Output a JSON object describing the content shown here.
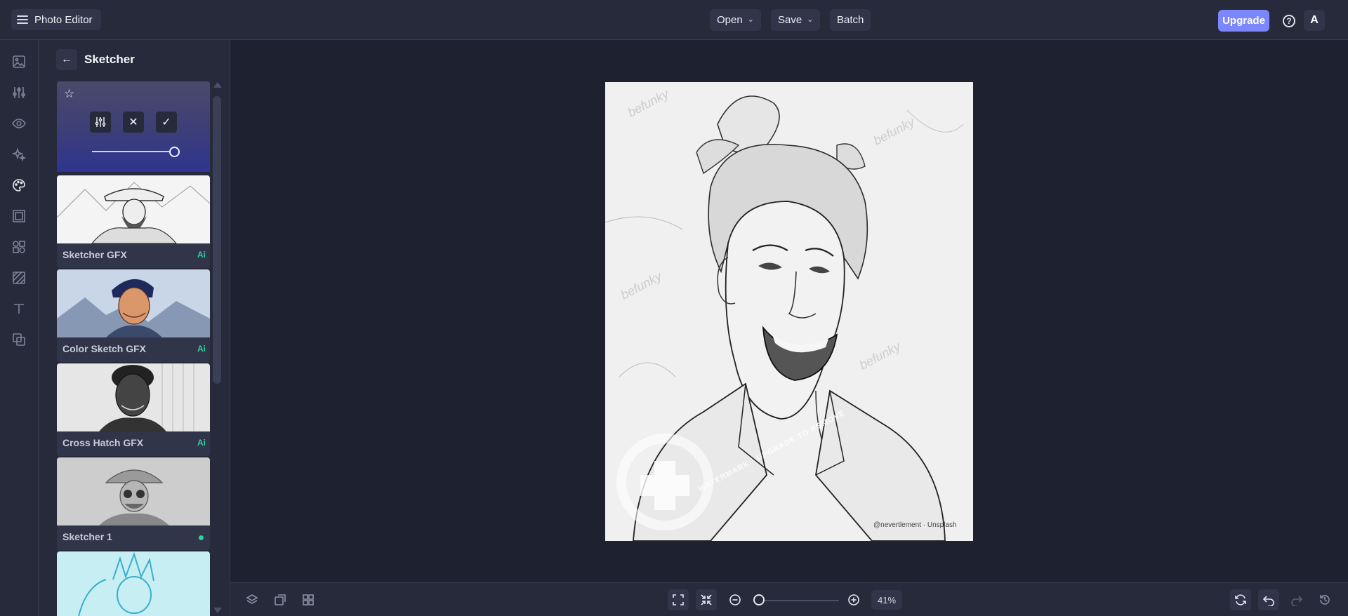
{
  "header": {
    "app_title": "Photo Editor",
    "menus": [
      {
        "label": "Open",
        "has_dropdown": true
      },
      {
        "label": "Save",
        "has_dropdown": true
      },
      {
        "label": "Batch",
        "has_dropdown": false
      }
    ],
    "upgrade_label": "Upgrade",
    "help_glyph": "?",
    "avatar_letter": "A"
  },
  "rail": {
    "icons": [
      "image-icon",
      "sliders-icon",
      "eye-icon",
      "sparkles-icon",
      "palette-icon",
      "frame-icon",
      "shapes-icon",
      "texture-icon",
      "text-icon",
      "overlay-icon"
    ],
    "active": "palette-icon"
  },
  "panel": {
    "title": "Sketcher",
    "slider_value_percent": 100,
    "filters": [
      {
        "name": "Sketcher GFX",
        "badge": "Ai"
      },
      {
        "name": "Color Sketch GFX",
        "badge": "Ai"
      },
      {
        "name": "Cross Hatch GFX",
        "badge": "Ai"
      },
      {
        "name": "Sketcher 1",
        "badge": "dot"
      },
      {
        "name": "",
        "badge": ""
      }
    ]
  },
  "canvas": {
    "watermark_word": "befunky",
    "watermark_ring": "WATERMARK · UPGRADE TO REMOVE",
    "credit": "@nevertlement · Unsplash"
  },
  "footer": {
    "zoom_label": "41%",
    "zoom_percent": 41
  },
  "colors": {
    "accent": "#7b86ff",
    "ai_badge": "#2fd29a",
    "background": "#1e2130",
    "panel": "#262a3a"
  }
}
